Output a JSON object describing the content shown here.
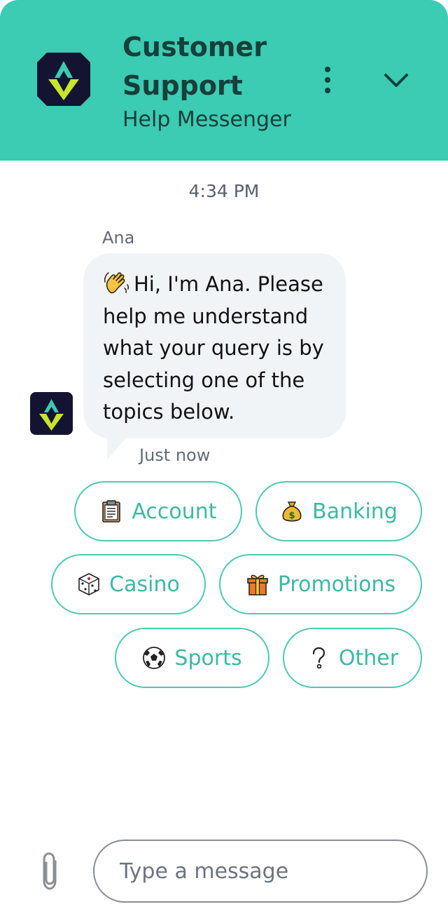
{
  "header": {
    "title": "Customer Support",
    "subtitle": "Help Messenger",
    "menu_icon": "more-vertical-icon",
    "collapse_icon": "chevron-down-icon",
    "logo_icon": "brand-logo-icon"
  },
  "conversation": {
    "timestamp": "4:34 PM",
    "sender": "Ana",
    "message_emoji": "waving-hand-icon",
    "message": "Hi, I'm Ana. Please help me understand what your query is by selecting one of the topics below.",
    "sent_time": "Just now"
  },
  "topics": [
    {
      "label": "Account",
      "icon": "clipboard-icon"
    },
    {
      "label": "Banking",
      "icon": "money-bag-icon"
    },
    {
      "label": "Casino",
      "icon": "dice-icon"
    },
    {
      "label": "Promotions",
      "icon": "gift-icon"
    },
    {
      "label": "Sports",
      "icon": "soccer-ball-icon"
    },
    {
      "label": "Other",
      "icon": "question-mark-icon"
    }
  ],
  "composer": {
    "placeholder": "Type a message",
    "value": "",
    "attach_icon": "paperclip-icon"
  },
  "colors": {
    "header_bg": "#3ccbb3",
    "header_text": "#16403a",
    "accent": "#3cb9a4",
    "bubble_bg": "#f1f4f7",
    "logo_bg": "#141432"
  }
}
